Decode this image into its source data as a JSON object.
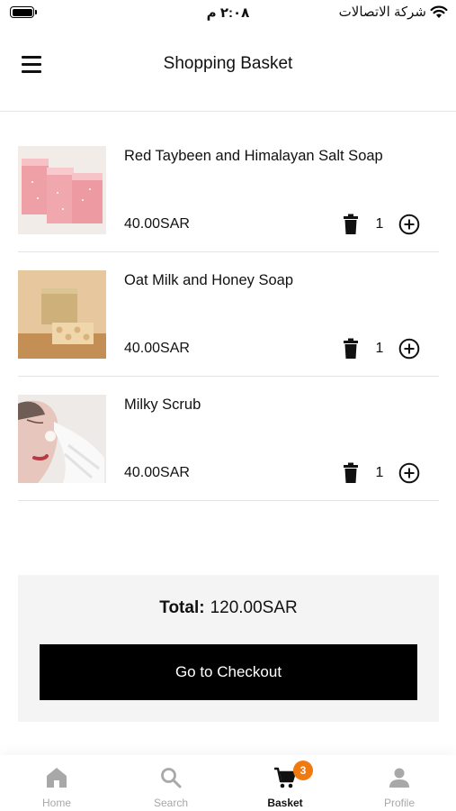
{
  "status_bar": {
    "time": "٢:٠٨ م",
    "carrier": "شركة الاتصالات"
  },
  "header": {
    "title": "Shopping Basket"
  },
  "basket": {
    "items": [
      {
        "name": "Red Taybeen and Himalayan Salt Soap",
        "price": "40.00SAR",
        "quantity": "1",
        "image": "pink-soap-bars"
      },
      {
        "name": "Oat Milk and Honey Soap",
        "price": "40.00SAR",
        "quantity": "1",
        "image": "honey-soap-bar"
      },
      {
        "name": "Milky Scrub",
        "price": "40.00SAR",
        "quantity": "1",
        "image": "face-scrub-portrait"
      }
    ]
  },
  "summary": {
    "total_label": "Total:",
    "total_value": "120.00SAR",
    "checkout_label": "Go to Checkout"
  },
  "bottom_nav": {
    "items": [
      {
        "label": "Home",
        "icon": "home-icon"
      },
      {
        "label": "Search",
        "icon": "search-icon"
      },
      {
        "label": "Basket",
        "icon": "cart-icon",
        "badge": "3",
        "active": true
      },
      {
        "label": "Profile",
        "icon": "person-icon"
      }
    ]
  },
  "colors": {
    "accent": "#f07a10",
    "primary": "#000000",
    "summary_bg": "#f4f4f4",
    "inactive": "#a8a8a8"
  }
}
